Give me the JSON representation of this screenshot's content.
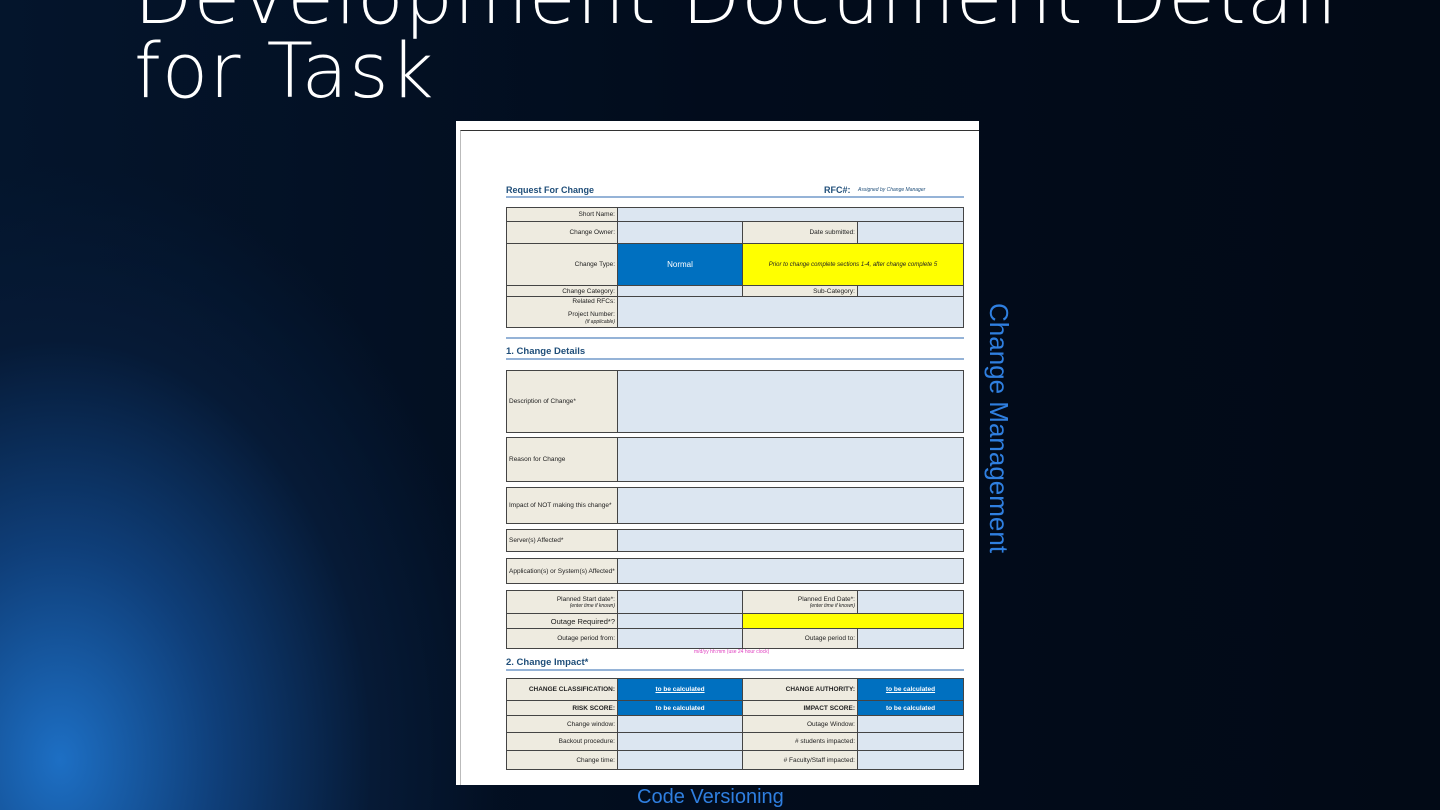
{
  "slide": {
    "title": "Development Document Detail for Task",
    "side_label": "Change Management",
    "bottom_label": "Code Versioning"
  },
  "doc": {
    "header": "Request For Change",
    "rfc_label": "RFC#:",
    "rfc_note": "Assigned by Change Manager",
    "short_name": "Short Name:",
    "change_owner": "Change Owner:",
    "date_submitted": "Date submitted:",
    "change_type": "Change Type:",
    "change_type_value": "Normal",
    "change_type_note": "Prior to change complete sections 1-4, after change complete 5",
    "change_category": "Change Category:",
    "sub_category": "Sub-Category:",
    "related_rfcs": "Related RFCs:",
    "project_number": "Project Number:",
    "if_applicable": "(if applicable)",
    "section1": "1. Change Details",
    "description": "Description of Change*",
    "reason": "Reason for Change",
    "impact_not": "Impact of NOT making this change*",
    "servers": "Server(s) Affected*",
    "applications": "Application(s) or System(s) Affected*",
    "planned_start": "Planned Start date*:",
    "planned_end": "Planned End Date*:",
    "enter_time": "(enter time if known)",
    "outage_required": "Outage Required*?",
    "outage_from": "Outage period from:",
    "outage_to": "Outage period to:",
    "time_note": "m/d/yy hh:mm (use 24 hour clock)",
    "section2": "2. Change Impact*",
    "classification": "CHANGE CLASSIFICATION:",
    "authority": "CHANGE AUTHORITY:",
    "risk": "RISK SCORE:",
    "impact_score": "IMPACT SCORE:",
    "tbc": "to be calculated",
    "change_window": "Change window:",
    "outage_window": "Outage Window:",
    "backout": "Backout procedure:",
    "students": "# students impacted:",
    "change_time": "Change time:",
    "faculty": "# Faculty/Staff impacted:"
  }
}
